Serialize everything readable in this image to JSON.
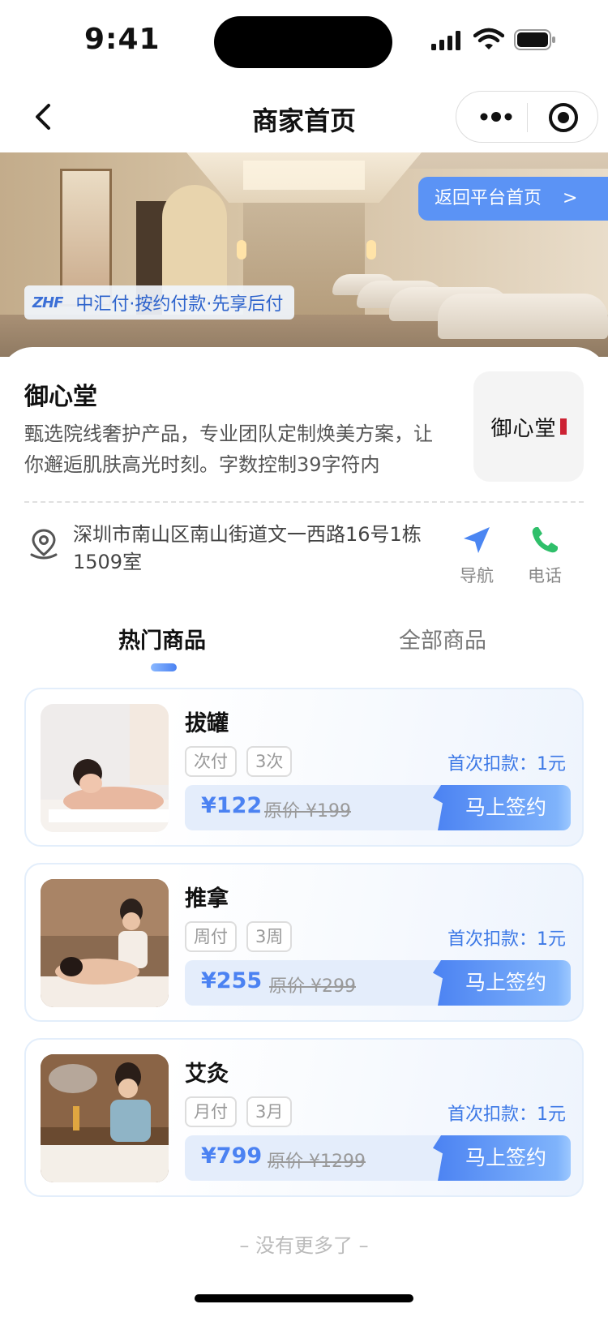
{
  "status_bar": {
    "time": "9:41"
  },
  "nav": {
    "title": "商家首页"
  },
  "banner": {
    "back_home_label": "返回平台首页",
    "back_home_chevron": ">",
    "pay_brand": "ZHF",
    "pay_text": "中汇付·按约付款·先享后付"
  },
  "merchant": {
    "name": "御心堂",
    "description": "甄选院线奢护产品，专业团队定制焕美方案，让你邂逅肌肤高光时刻。字数控制39字符内",
    "logo_text": "御心堂",
    "address": "深圳市南山区南山街道文一西路16号1栋1509室",
    "actions": {
      "navigate": "导航",
      "phone": "电话"
    },
    "accent_color": "#3c78e6"
  },
  "tabs": [
    {
      "label": "热门商品",
      "active": true
    },
    {
      "label": "全部商品",
      "active": false
    }
  ],
  "products": [
    {
      "name": "拔罐",
      "chips": [
        "次付",
        "3次"
      ],
      "first_charge": "首次扣款：1元",
      "price": "¥122",
      "original_price": "原价 ¥199",
      "cta": "马上签约"
    },
    {
      "name": "推拿",
      "chips": [
        "周付",
        "3周"
      ],
      "first_charge": "首次扣款：1元",
      "price": "¥255",
      "original_price": "原价 ¥299",
      "cta": "马上签约"
    },
    {
      "name": "艾灸",
      "chips": [
        "月付",
        "3月"
      ],
      "first_charge": "首次扣款：1元",
      "price": "¥799",
      "original_price": "原价 ¥1299",
      "cta": "马上签约"
    }
  ],
  "footer": {
    "no_more": "– 没有更多了 –"
  }
}
